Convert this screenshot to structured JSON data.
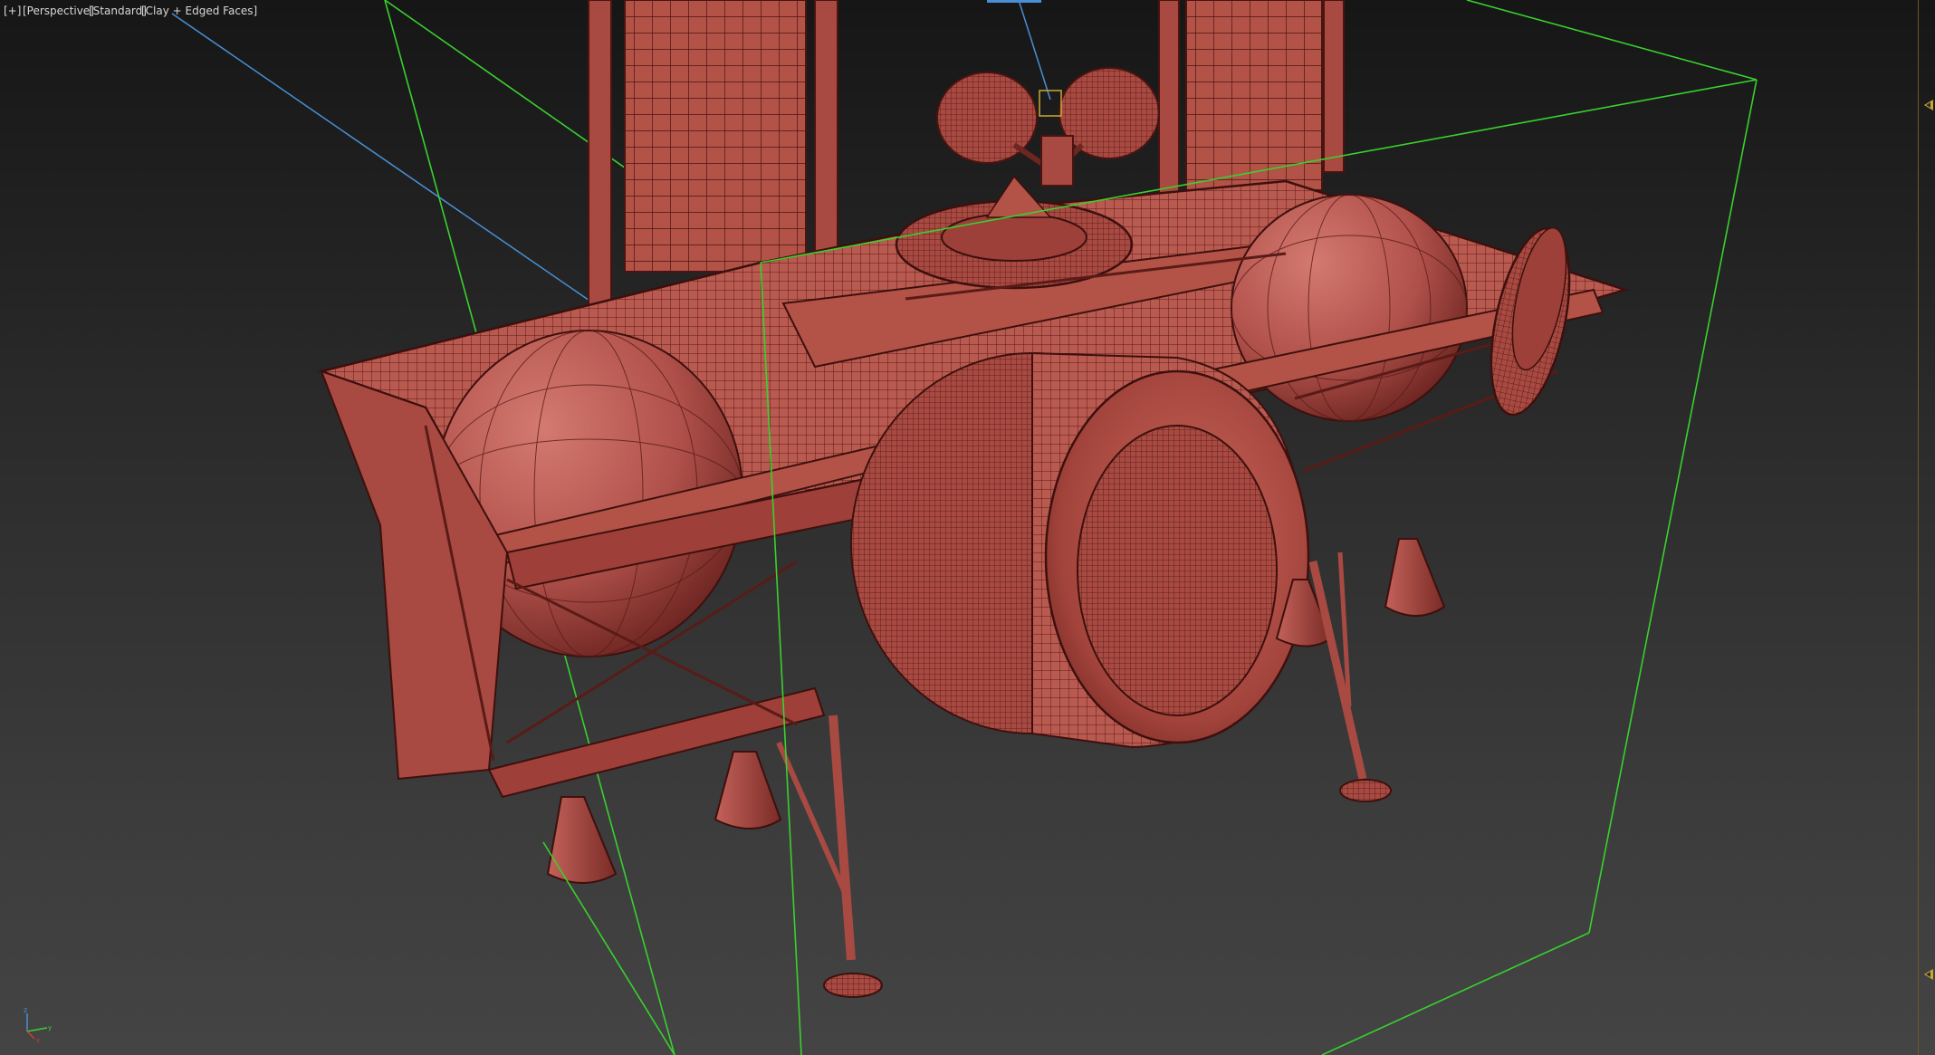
{
  "viewport": {
    "labels": {
      "plus": "[+]",
      "view": "[Perspective]",
      "shading": "[Standard]",
      "display_mode": "[Clay + Edged Faces]"
    },
    "background_top": "#161616",
    "background_bottom": "#444444",
    "model_color": "#b5584f",
    "wire_color": "#4a1512",
    "bounding_box_color": "#39d12e",
    "gizmo": {
      "axis_z_label": "z",
      "axis_x_label": "x",
      "axis_y_label": "y"
    }
  }
}
